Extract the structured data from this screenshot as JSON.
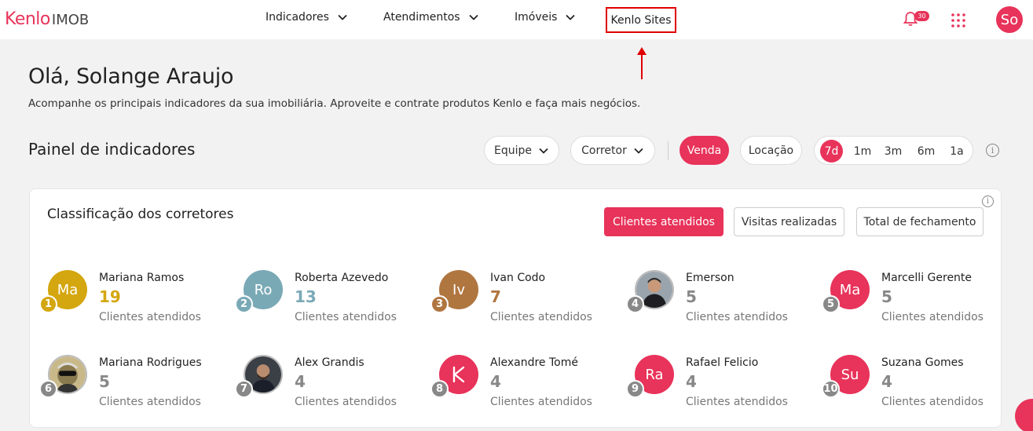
{
  "header": {
    "logo_mark": "Kenlo",
    "logo_sub": "IMOB",
    "nav": [
      {
        "label": "Indicadores",
        "icon": "chevron-down-icon"
      },
      {
        "label": "Atendimentos",
        "icon": "chevron-down-icon"
      },
      {
        "label": "Imóveis",
        "icon": "chevron-down-icon"
      },
      {
        "label": "Kenlo Sites"
      }
    ],
    "notifications_count": "30",
    "user_initials": "So"
  },
  "greeting": {
    "title": "Olá, Solange Araujo",
    "subtitle": "Acompanhe os principais indicadores da sua imobiliária. Aproveite e contrate produtos Kenlo e faça mais negócios."
  },
  "panel": {
    "title": "Painel de indicadores",
    "filters": {
      "team": "Equipe",
      "broker": "Corretor"
    },
    "mode": {
      "sale": "Venda",
      "rent": "Locação",
      "selected": "Venda"
    },
    "periods": [
      "7d",
      "1m",
      "3m",
      "6m",
      "1a"
    ],
    "selected_period": "7d"
  },
  "ranking": {
    "title": "Classificação dos corretores",
    "tabs": [
      "Clientes atendidos",
      "Visitas realizadas",
      "Total de fechamento"
    ],
    "selected_tab": "Clientes atendidos",
    "metric_label": "Clientes atendidos",
    "people": [
      {
        "rank": "1",
        "name": "Mariana Ramos",
        "count": "19",
        "initials": "Ma",
        "color": "#d4a60f",
        "count_color": "#d4a60f"
      },
      {
        "rank": "2",
        "name": "Roberta Azevedo",
        "count": "13",
        "initials": "Ro",
        "color": "#7aa9b6",
        "count_color": "#7aa9b6"
      },
      {
        "rank": "3",
        "name": "Ivan Codo",
        "count": "7",
        "initials": "Iv",
        "color": "#b07640",
        "count_color": "#b07640"
      },
      {
        "rank": "4",
        "name": "Emerson",
        "count": "5",
        "initials": "",
        "color": "#888888",
        "count_color": "#888888",
        "photo": "man-photo"
      },
      {
        "rank": "5",
        "name": "Marcelli Gerente",
        "count": "5",
        "initials": "Ma",
        "color": "#e8335a",
        "count_color": "#888888"
      },
      {
        "rank": "6",
        "name": "Mariana Rodrigues",
        "count": "5",
        "initials": "",
        "color": "#888888",
        "count_color": "#888888",
        "photo": "cartoon-photo"
      },
      {
        "rank": "7",
        "name": "Alex Grandis",
        "count": "4",
        "initials": "",
        "color": "#888888",
        "count_color": "#888888",
        "photo": "man-photo"
      },
      {
        "rank": "8",
        "name": "Alexandre Tomé",
        "count": "4",
        "initials": "K",
        "color": "#e8335a",
        "count_color": "#888888"
      },
      {
        "rank": "9",
        "name": "Rafael Felicio",
        "count": "4",
        "initials": "Ra",
        "color": "#e8335a",
        "count_color": "#888888"
      },
      {
        "rank": "10",
        "name": "Suzana Gomes",
        "count": "4",
        "initials": "Su",
        "color": "#e8335a",
        "count_color": "#888888"
      }
    ]
  }
}
